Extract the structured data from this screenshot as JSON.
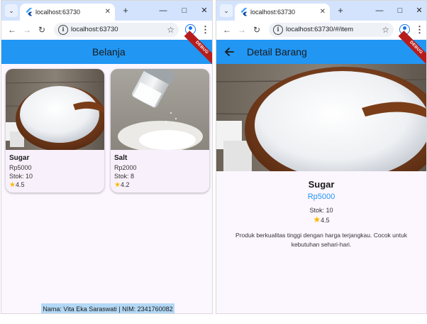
{
  "left_window": {
    "tab_title": "localhost:63730",
    "url": "localhost:63730",
    "app_bar_title": "Belanja",
    "debug_label": "DEBUG",
    "products": [
      {
        "name": "Sugar",
        "price": "Rp5000",
        "stock": "Stok: 10",
        "rating": "4.5"
      },
      {
        "name": "Salt",
        "price": "Rp2000",
        "stock": "Stok: 8",
        "rating": "4.2"
      }
    ],
    "footer": "Nama: Vita Eka Saraswati | NIM: 2341760082"
  },
  "right_window": {
    "tab_title": "localhost:63730",
    "url": "localhost:63730/#/item",
    "app_bar_title": "Detail Barang",
    "debug_label": "DEBUG",
    "detail": {
      "name": "Sugar",
      "price": "Rp5000",
      "stock": "Stok: 10",
      "rating": "4.5",
      "description": "Produk berkualitas tinggi dengan harga terjangkau. Cocok untuk kebutuhan sehari-hari."
    }
  },
  "icons": {
    "tab_list": "chevron-down-icon",
    "favicon": "flutter-icon",
    "tab_close": "close-icon",
    "new_tab": "plus-icon",
    "minimize": "minimize-icon",
    "maximize": "maximize-icon",
    "close_window": "close-icon",
    "back": "arrow-left-icon",
    "forward": "arrow-right-icon",
    "reload": "reload-icon",
    "site_info": "info-icon",
    "bookmark": "star-icon",
    "profile": "profile-icon",
    "menu": "kebab-menu-icon",
    "rating_star": "star-icon"
  },
  "colors": {
    "tab_strip": "#d3e3fd",
    "app_bar": "#2196f3",
    "price_accent": "#2196f3",
    "rating_star": "#f9b900",
    "debug_banner": "#b71c1c",
    "page_background": "#fcf6ff",
    "footer_background": "#b3d8f5"
  }
}
